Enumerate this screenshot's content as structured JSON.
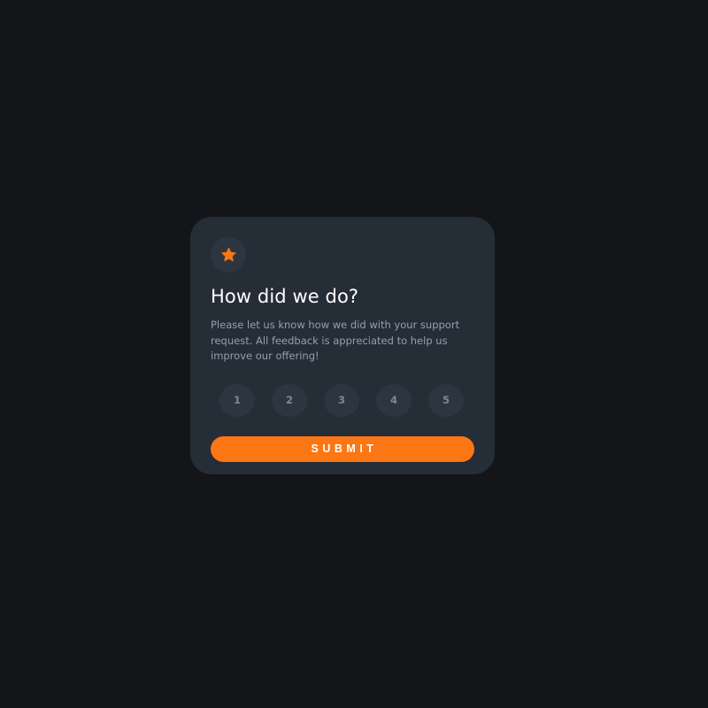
{
  "card": {
    "icon": "star-icon",
    "title": "How did we do?",
    "description": "Please let us know how we did with your support request. All feedback is appreciated to help us improve our offering!",
    "ratings": [
      "1",
      "2",
      "3",
      "4",
      "5"
    ],
    "submit_label": "SUBMIT"
  },
  "colors": {
    "page_background": "#131518",
    "card_background": "#252d37",
    "accent": "#fc7614",
    "circle_background": "#2d3640",
    "body_text": "#969fad",
    "rating_text": "#7c8798"
  }
}
